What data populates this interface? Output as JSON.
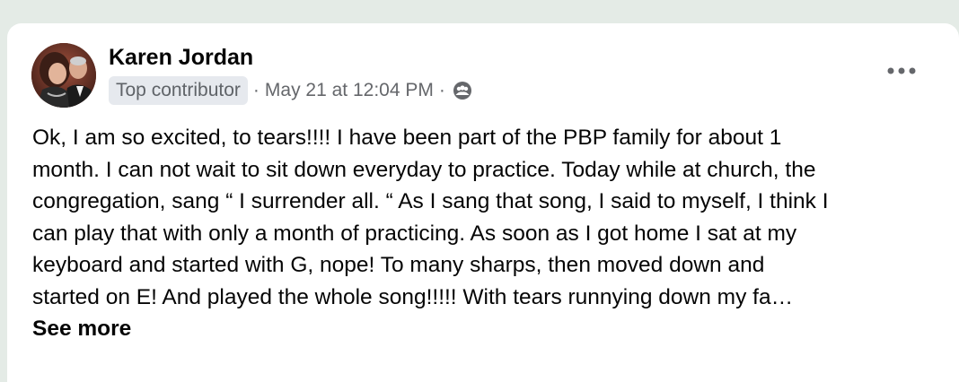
{
  "post": {
    "author_name": "Karen Jordan",
    "badge": "Top contributor",
    "separator": "·",
    "timestamp": "May 21 at 12:04 PM",
    "audience_icon": "group-icon",
    "more_icon": "more-horizontal-icon",
    "text_lines": [
      "Ok, I am so excited, to tears!!!! I have been part of the PBP family for about 1",
      "month. I can not wait to sit down everyday to practice. Today while at church, the",
      "congregation, sang “ I surrender all. “ As I sang that song, I said to myself, I think I",
      "can play that with only a month of practicing. As soon as I got home I sat at my",
      "keyboard and started with G, nope! To many sharps, then moved down and",
      "started on E! And played the whole song!!!!! With tears runnying down my fa…"
    ],
    "see_more_label": "See more"
  },
  "colors": {
    "page_background": "#e4ebe6",
    "card_background": "#ffffff",
    "text_primary": "#050505",
    "text_secondary": "#65676b",
    "badge_background": "#e6e9ee"
  }
}
